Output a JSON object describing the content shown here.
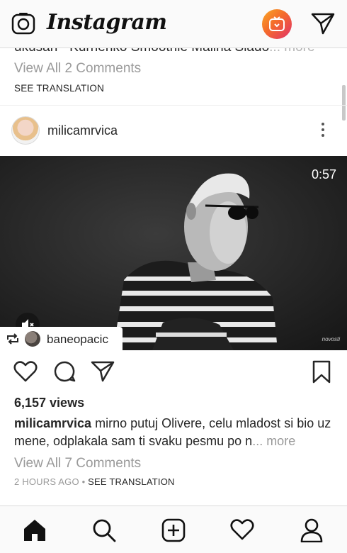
{
  "header": {
    "logo_text": "Instagram",
    "icons": [
      "camera-icon",
      "igtv-icon",
      "direct-send-icon"
    ]
  },
  "previous_post": {
    "caption_tail": "ukusan - Kurrienko Smoothie Malina Siado",
    "more_label": "... more",
    "view_all_comments": "View All 2 Comments",
    "see_translation": "SEE TRANSLATION"
  },
  "post": {
    "username": "milicamrvica",
    "video_duration": "0:57",
    "watermark": "novosti",
    "reposted_from": "baneopacic",
    "views": "6,157 views",
    "caption_user": "milicamrvica",
    "caption_text": " mirno putuj Olivere, celu mladost si bio uz mene, odplakala sam ti svaku pesmu po n",
    "caption_more": "... more",
    "view_all_comments": "View All 7 Comments",
    "time_ago": "2 HOURS AGO",
    "meta_sep": " • ",
    "see_translation": "SEE TRANSLATION"
  },
  "bottom_nav": [
    "home-icon",
    "search-icon",
    "new-post-icon",
    "activity-heart-icon",
    "profile-icon"
  ],
  "colors": {
    "text": "#262626",
    "muted": "#999999",
    "igtv_gradient_start": "#f9a825",
    "igtv_gradient_end": "#e1306c"
  }
}
